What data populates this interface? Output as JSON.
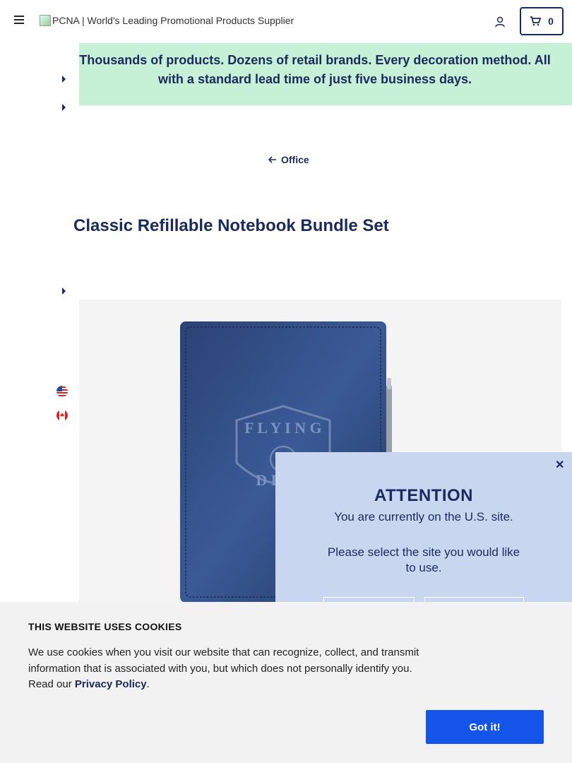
{
  "header": {
    "logo_alt": "PCNA | World's Leading Promotional Products Supplier",
    "cart_count": "0"
  },
  "banner": {
    "text": "Thousands of products. Dozens of retail brands. Every decoration method. All with a standard lead time of just five business days."
  },
  "breadcrumb": {
    "back_label": "Office"
  },
  "product": {
    "title": "Classic Refillable Notebook Bundle Set"
  },
  "attention": {
    "title": "ATTENTION",
    "message": "You are currently on the U.S. site.",
    "prompt": "Please select the site you would like to use."
  },
  "cookie_banner": {
    "title": "THIS WEBSITE USES COOKIES",
    "body": "We use cookies when you visit our website that can recognize, collect, and transmit information that is associated with you, but which does not personally identify you. Read our ",
    "link": "Privacy Policy",
    "period": ".",
    "accept_label": "Got it!"
  },
  "colors": {
    "navy": "#1a2a5c",
    "banner_bg": "#c6f1d6",
    "attention_bg": "#c9d6f0",
    "accept_button": "#1554e8"
  }
}
